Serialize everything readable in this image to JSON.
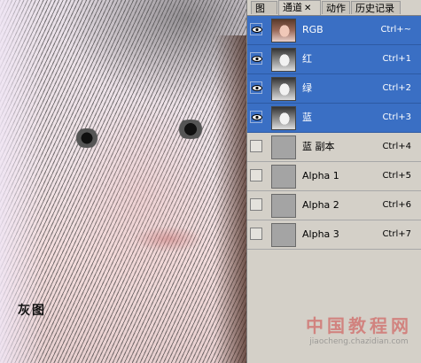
{
  "canvas": {
    "caption": "灰图"
  },
  "panel": {
    "tabs": [
      {
        "label": "图层",
        "active": false
      },
      {
        "label": "通道",
        "active": true,
        "closable": true
      },
      {
        "label": "动作",
        "active": false
      },
      {
        "label": "历史记录",
        "active": false
      }
    ],
    "channels": [
      {
        "name": "RGB",
        "shortcut": "Ctrl+~",
        "visible": true,
        "selected": true,
        "thumb": "color-thumbnail"
      },
      {
        "name": "红",
        "shortcut": "Ctrl+1",
        "visible": true,
        "selected": true,
        "thumb": "grayscale-thumbnail"
      },
      {
        "name": "绿",
        "shortcut": "Ctrl+2",
        "visible": true,
        "selected": true,
        "thumb": "grayscale-thumbnail"
      },
      {
        "name": "蓝",
        "shortcut": "Ctrl+3",
        "visible": true,
        "selected": true,
        "thumb": "grayscale-thumbnail"
      },
      {
        "name": "蓝 副本",
        "shortcut": "Ctrl+4",
        "visible": false,
        "selected": false,
        "thumb": "gray-fill-thumbnail"
      },
      {
        "name": "Alpha 1",
        "shortcut": "Ctrl+5",
        "visible": false,
        "selected": false,
        "thumb": "gray-fill-thumbnail"
      },
      {
        "name": "Alpha 2",
        "shortcut": "Ctrl+6",
        "visible": false,
        "selected": false,
        "thumb": "gray-fill-thumbnail"
      },
      {
        "name": "Alpha 3",
        "shortcut": "Ctrl+7",
        "visible": false,
        "selected": false,
        "thumb": "gray-fill-thumbnail"
      }
    ]
  },
  "watermark": {
    "line1": "中国教程网",
    "line2": "jiaocheng.chazidian.com"
  },
  "colors": {
    "selection": "#3a6fc4",
    "panel_bg": "#d4d0c8"
  }
}
